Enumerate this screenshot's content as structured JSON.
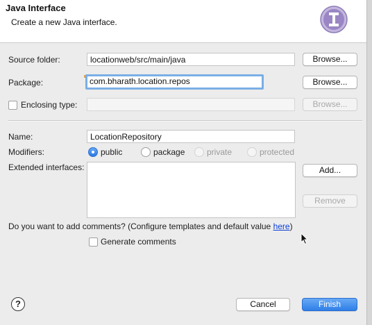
{
  "header": {
    "title": "Java Interface",
    "subtitle": "Create a new Java interface.",
    "icon_name": "interface-icon",
    "icon_letter": "I",
    "icon_color": "#9a86c4"
  },
  "form": {
    "source_folder": {
      "label": "Source folder:",
      "value": "locationweb/src/main/java",
      "browse_label": "Browse..."
    },
    "package": {
      "label": "Package:",
      "value": "com.bharath.location.repos",
      "browse_label": "Browse..."
    },
    "enclosing_type": {
      "label": "Enclosing type:",
      "value": "",
      "browse_label": "Browse...",
      "checked": false
    },
    "name": {
      "label": "Name:",
      "value": "LocationRepository"
    },
    "modifiers": {
      "label": "Modifiers:",
      "options": [
        {
          "label": "public",
          "selected": true,
          "enabled": true
        },
        {
          "label": "package",
          "selected": false,
          "enabled": true
        },
        {
          "label": "private",
          "selected": false,
          "enabled": false
        },
        {
          "label": "protected",
          "selected": false,
          "enabled": false
        }
      ]
    },
    "extended_interfaces": {
      "label": "Extended interfaces:",
      "add_label": "Add...",
      "remove_label": "Remove",
      "items": []
    },
    "comments": {
      "question": "Do you want to add comments? (Configure templates and default value ",
      "link": "here",
      "question_end": ")",
      "generate_label": "Generate comments",
      "generate_checked": false
    }
  },
  "footer": {
    "help_label": "?",
    "cancel_label": "Cancel",
    "finish_label": "Finish"
  },
  "colors": {
    "accent": "#2f7fe8",
    "focus_ring": "#7aaee6",
    "link": "#0b3fd8"
  }
}
